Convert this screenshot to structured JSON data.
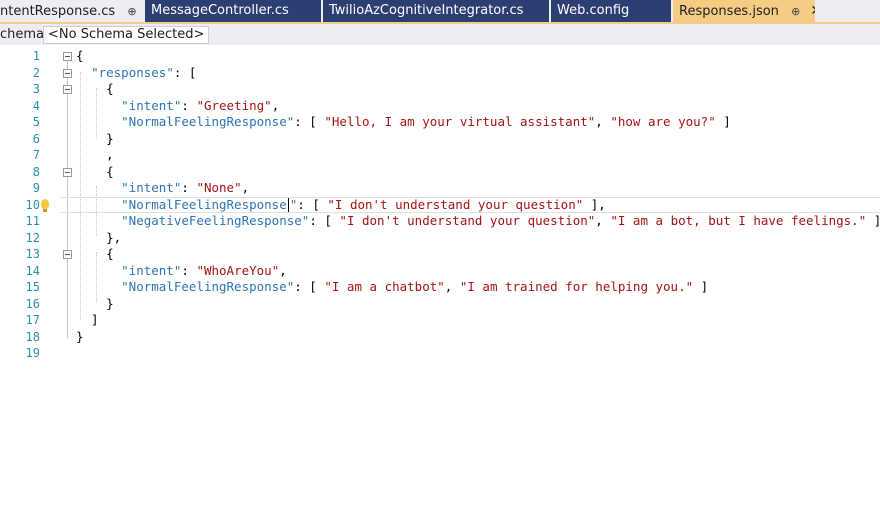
{
  "tabs": [
    {
      "label": "ntentResponse.cs",
      "pinned": true,
      "closable": true
    },
    {
      "label": "MessageController.cs"
    },
    {
      "label": "TwilioAzCognitiveIntegrator.cs"
    },
    {
      "label": "Web.config"
    },
    {
      "label": "Responses.json",
      "pinned": true,
      "closable": true,
      "active": true
    }
  ],
  "tab_icons": {
    "pin": "pin-icon",
    "close": "close-icon"
  },
  "tab_glyphs": {
    "pin": "⊕",
    "close": "✕"
  },
  "schema": {
    "label": "chema:",
    "selected": "<No Schema Selected>"
  },
  "editor": {
    "current_line": 10,
    "lightbulb_line": 10,
    "lines": [
      {
        "n": "1",
        "tokens": [
          [
            "p",
            "{"
          ]
        ]
      },
      {
        "n": "2",
        "tokens": [
          [
            "p",
            "  "
          ],
          [
            "k",
            "\"responses\""
          ],
          [
            "p",
            ": ["
          ]
        ]
      },
      {
        "n": "3",
        "tokens": [
          [
            "p",
            "    {"
          ]
        ]
      },
      {
        "n": "4",
        "tokens": [
          [
            "p",
            "      "
          ],
          [
            "k",
            "\"intent\""
          ],
          [
            "p",
            ": "
          ],
          [
            "s",
            "\"Greeting\""
          ],
          [
            "p",
            ","
          ]
        ]
      },
      {
        "n": "5",
        "tokens": [
          [
            "p",
            "      "
          ],
          [
            "k",
            "\"NormalFeelingResponse\""
          ],
          [
            "p",
            ": [ "
          ],
          [
            "s",
            "\"Hello, I am your virtual assistant\""
          ],
          [
            "p",
            ", "
          ],
          [
            "s",
            "\"how are you?\""
          ],
          [
            "p",
            " ]"
          ]
        ]
      },
      {
        "n": "6",
        "tokens": [
          [
            "p",
            "    }"
          ]
        ]
      },
      {
        "n": "7",
        "tokens": [
          [
            "p",
            "    ,"
          ]
        ]
      },
      {
        "n": "8",
        "tokens": [
          [
            "p",
            "    {"
          ]
        ]
      },
      {
        "n": "9",
        "tokens": [
          [
            "p",
            "      "
          ],
          [
            "k",
            "\"intent\""
          ],
          [
            "p",
            ": "
          ],
          [
            "s",
            "\"None\""
          ],
          [
            "p",
            ","
          ]
        ]
      },
      {
        "n": "10",
        "tokens": [
          [
            "p",
            "      "
          ],
          [
            "k",
            "\"NormalFeelingResponse"
          ],
          [
            "caret",
            ""
          ],
          [
            "k",
            "\""
          ],
          [
            "p",
            ": [ "
          ],
          [
            "s",
            "\"I don't understand your question\""
          ],
          [
            "p",
            " ],"
          ]
        ]
      },
      {
        "n": "11",
        "tokens": [
          [
            "p",
            "      "
          ],
          [
            "k",
            "\"NegativeFeelingResponse\""
          ],
          [
            "p",
            ": [ "
          ],
          [
            "s",
            "\"I don't understand your question\""
          ],
          [
            "p",
            ", "
          ],
          [
            "s",
            "\"I am a bot, but I have feelings.\""
          ],
          [
            "p",
            " ]"
          ]
        ]
      },
      {
        "n": "12",
        "tokens": [
          [
            "p",
            "    },"
          ]
        ]
      },
      {
        "n": "13",
        "tokens": [
          [
            "p",
            "    {"
          ]
        ]
      },
      {
        "n": "14",
        "tokens": [
          [
            "p",
            "      "
          ],
          [
            "k",
            "\"intent\""
          ],
          [
            "p",
            ": "
          ],
          [
            "s",
            "\"WhoAreYou\""
          ],
          [
            "p",
            ","
          ]
        ]
      },
      {
        "n": "15",
        "tokens": [
          [
            "p",
            "      "
          ],
          [
            "k",
            "\"NormalFeelingResponse\""
          ],
          [
            "p",
            ": [ "
          ],
          [
            "s",
            "\"I am a chatbot\""
          ],
          [
            "p",
            ", "
          ],
          [
            "s",
            "\"I am trained for helping you.\""
          ],
          [
            "p",
            " ]"
          ]
        ]
      },
      {
        "n": "16",
        "tokens": [
          [
            "p",
            "    }"
          ]
        ]
      },
      {
        "n": "17",
        "tokens": [
          [
            "p",
            "  ]"
          ]
        ]
      },
      {
        "n": "18",
        "tokens": [
          [
            "p",
            "}"
          ]
        ]
      },
      {
        "n": "19",
        "tokens": []
      }
    ],
    "fold_lines": [
      1,
      2,
      3,
      8,
      13
    ]
  }
}
